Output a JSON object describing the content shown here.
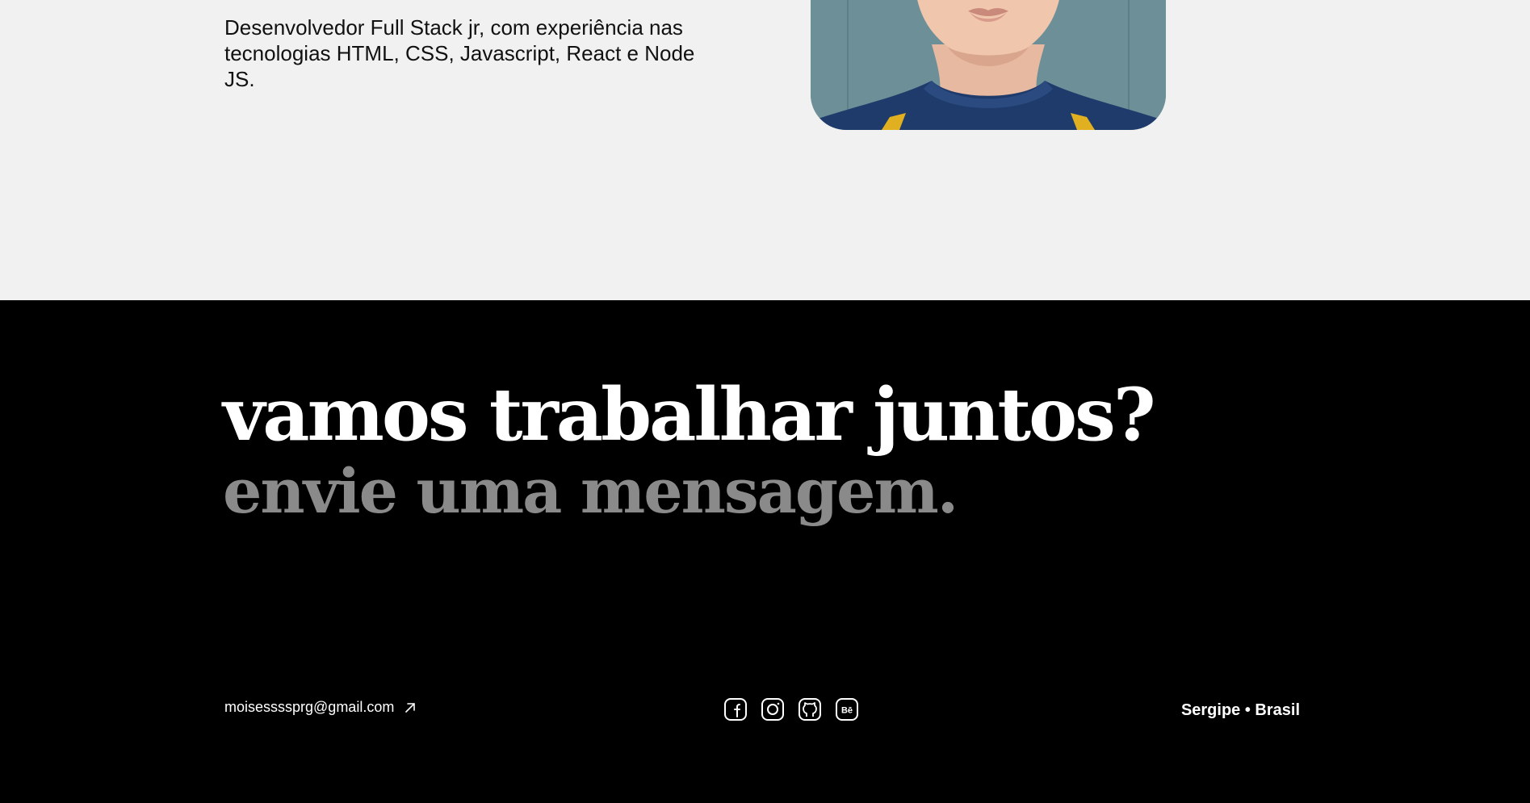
{
  "about": {
    "description": "Desenvolvedor Full Stack jr, com experiência nas tecnologias HTML, CSS, Javascript, React e Node JS."
  },
  "contact": {
    "headline": "vamos trabalhar juntos?",
    "subheadline": "envie uma mensagem.",
    "email": "moisessssprg@gmail.com",
    "email_icon": "arrow-up-right-icon",
    "socials": [
      {
        "name": "facebook",
        "icon": "facebook-icon"
      },
      {
        "name": "instagram",
        "icon": "instagram-icon"
      },
      {
        "name": "github",
        "icon": "github-icon"
      },
      {
        "name": "behance",
        "icon": "behance-icon"
      }
    ],
    "location": "Sergipe • Brasil"
  },
  "colors": {
    "about_background": "#f1f1f1",
    "contact_background": "#000000",
    "headline": "#ffffff",
    "subheadline": "#8a8a8a",
    "portrait_background": "#6d8f98"
  }
}
